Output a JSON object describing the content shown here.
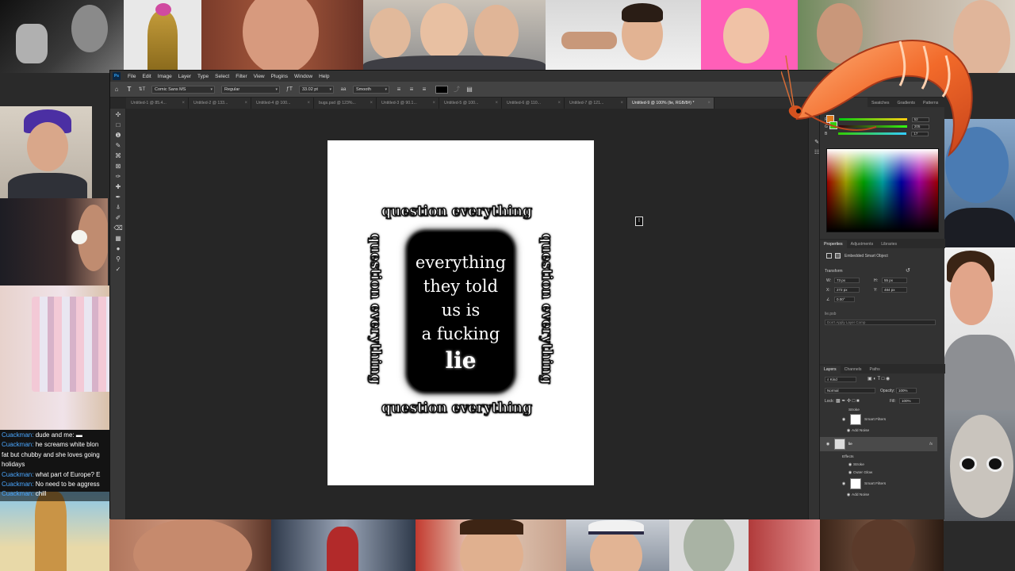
{
  "menubar": {
    "logo": "Ps",
    "items": [
      "File",
      "Edit",
      "Image",
      "Layer",
      "Type",
      "Select",
      "Filter",
      "View",
      "Plugins",
      "Window",
      "Help"
    ]
  },
  "options_bar": {
    "font_family": "Comic Sans MS",
    "font_style": "Regular",
    "font_size": "33.02 pt",
    "antialias": "Smooth"
  },
  "doc_tabs": [
    "Untitled-1 @ 85.4...",
    "Untitled-2 @ 133...",
    "Untitled-4 @ 100...",
    "bugs.psd @ 123%...",
    "Untitled-3 @ 90.1...",
    "Untitled-5 @ 100...",
    "Untitled-6 @ 110...",
    "Untitled-7 @ 121...",
    "Untitled-8 @ 100...",
    "Untitled-9 @ 100% (lie, RGB/8#) *"
  ],
  "canvas": {
    "border_text": "question everything",
    "center_lines": [
      "everything",
      "they told",
      "us is",
      "a fucking"
    ],
    "center_emphasis": "lie"
  },
  "color_panel": {
    "tabs": [
      "Swatches",
      "Gradients",
      "Patterns"
    ],
    "sliders": [
      {
        "label": "R",
        "value": "52",
        "color": "#3cd83c"
      },
      {
        "label": "G",
        "value": "205",
        "color": "#3cd83c"
      },
      {
        "label": "B",
        "value": "17",
        "color": "#3cd83c"
      }
    ]
  },
  "properties": {
    "tabs": [
      "Properties",
      "Adjustments",
      "Libraries"
    ],
    "object_type": "Embedded Smart Object",
    "section": "Transform",
    "w_label": "W:",
    "w_value": "73 px",
    "h_label": "H:",
    "h_value": "55 px",
    "x_label": "X:",
    "x_value": "272 px",
    "y_label": "Y:",
    "y_value": "484 px",
    "angle": "0.00°",
    "file_name": "lie.psb",
    "comp_button": "Don't Apply Layer Comp"
  },
  "layers": {
    "tabs": [
      "Layers",
      "Channels",
      "Paths"
    ],
    "filter_kind": "Kind",
    "blend_mode": "Normal",
    "opacity_label": "Opacity:",
    "opacity_value": "100%",
    "lock_label": "Lock:",
    "fill_label": "Fill:",
    "fill_value": "100%",
    "rows": [
      {
        "label": "Stroke"
      },
      {
        "label": "Smart Filters"
      },
      {
        "label": "Add Noise"
      },
      {
        "label": "lie"
      },
      {
        "label": "Effects"
      },
      {
        "label": "Stroke"
      },
      {
        "label": "Outer Glow"
      },
      {
        "label": "Smart Filters"
      },
      {
        "label": "Add Noise"
      }
    ]
  },
  "chat": {
    "lines": [
      {
        "user": "Cuackman:",
        "text": " dude and me: ▬"
      },
      {
        "user": "Cuackman:",
        "text": " he screams white blon"
      },
      {
        "user": "",
        "text": "fat but chubby and she loves going"
      },
      {
        "user": "",
        "text": "holidays"
      },
      {
        "user": "Cuackman:",
        "text": " what part of Europe? E"
      },
      {
        "user": "Cuackman:",
        "text": " No need to be aggress"
      },
      {
        "user": "Cuackman:",
        "text": " chill"
      }
    ]
  }
}
